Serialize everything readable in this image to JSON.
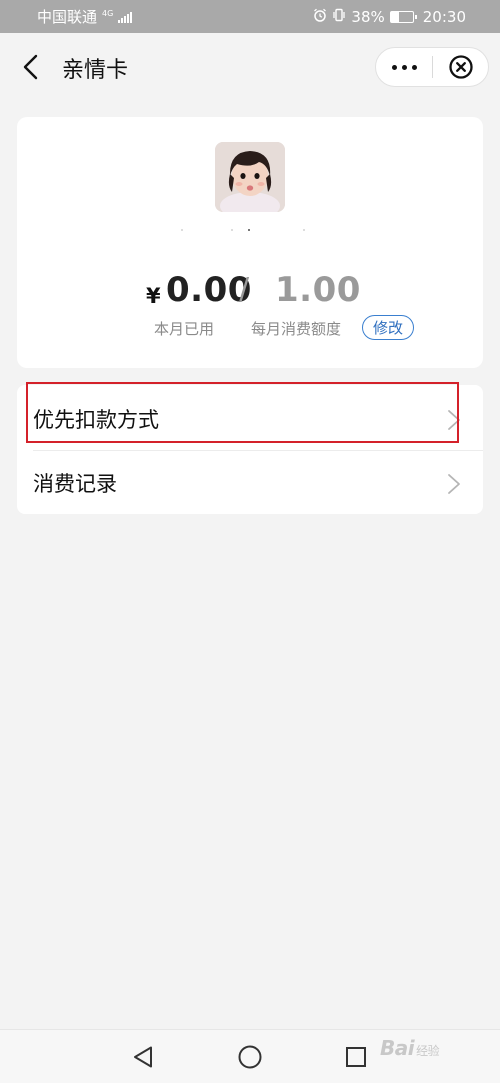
{
  "status_bar": {
    "carrier": "中国联通",
    "network": "4G",
    "battery": "38%",
    "battery_level": 0.38,
    "time": "20:30",
    "icons": [
      "signal-icon",
      "alarm-icon",
      "vibrate-icon",
      "battery-icon"
    ]
  },
  "nav": {
    "title": "亲情卡",
    "back_icon": "chevron-left-icon",
    "more_icon": "more-dots-icon",
    "close_icon": "close-circle-icon"
  },
  "card": {
    "currency": "¥",
    "used_amount": "0.00",
    "separator": "/",
    "limit_amount": "1.00",
    "used_label": "本月已用",
    "limit_label": "每月消费额度",
    "edit_label": "修改"
  },
  "list": {
    "items": [
      {
        "label": "优先扣款方式",
        "icon": "chevron-right-icon"
      },
      {
        "label": "消费记录",
        "icon": "chevron-right-icon"
      }
    ]
  },
  "system_nav": {
    "icons": [
      "triangle-back-icon",
      "circle-home-icon",
      "square-recent-icon"
    ]
  },
  "watermark": {
    "text": "Bai",
    "suffix": "经验"
  },
  "colors": {
    "accent_blue": "#2f6fbf",
    "highlight_red": "#d4212a",
    "background": "#f3f3f3",
    "status_bar": "#a9a9a9"
  }
}
